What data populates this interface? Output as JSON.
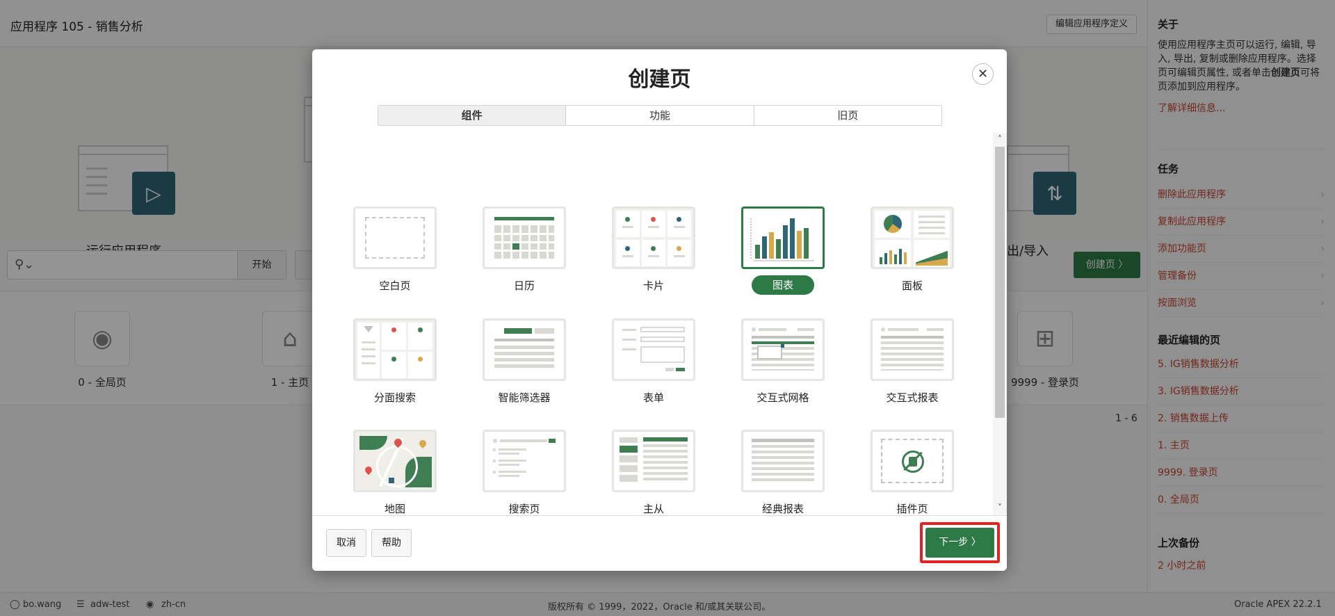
{
  "app": {
    "title": "应用程序 105 - 销售分析",
    "edit_definition_label": "编辑应用程序定义",
    "hero": {
      "run_label": "运行应用程序",
      "export_label": "出/导入"
    },
    "search": {
      "go_label": "开始",
      "value": "",
      "placeholder": ""
    },
    "create_page_label": "创建页 〉",
    "pages": [
      {
        "label": "0 - 全局页",
        "icon": "globe-icon"
      },
      {
        "label": "1 - 主页",
        "icon": "home-icon"
      },
      {
        "label": "9999 - 登录页",
        "icon": "lock-icon"
      }
    ],
    "pager_text": "1 - 6"
  },
  "sidebar": {
    "about_heading": "关于",
    "about_text_before": "使用应用程序主页可以运行, 编辑, 导入, 导出, 复制或删除应用程序。选择页可编辑页属性, 或者单击",
    "about_text_bold": "创建页",
    "about_text_after": "可将页添加到应用程序。",
    "learn_more": "了解详细信息...",
    "tasks_heading": "任务",
    "tasks": [
      "删除此应用程序",
      "复制此应用程序",
      "添加功能页",
      "管理备份",
      "按面浏览"
    ],
    "recent_heading": "最近编辑的页",
    "recent": [
      "5. IG销售数据分析",
      "3. IG销售数据分析",
      "2. 销售数据上传",
      "1. 主页",
      "9999. 登录页",
      "0. 全局页"
    ],
    "backup_heading": "上次备份",
    "backup_value": "2 小时之前"
  },
  "footer": {
    "user": "bo.wang",
    "workspace": "adw-test",
    "language": "zh-cn",
    "copyright": "版权所有 © 1999，2022，Oracle 和/或其关联公司。",
    "version": "Oracle APEX 22.2.1"
  },
  "modal": {
    "title": "创建页",
    "close_icon": "close-icon",
    "tabs": [
      {
        "label": "组件",
        "active": true
      },
      {
        "label": "功能",
        "active": false
      },
      {
        "label": "旧页",
        "active": false
      }
    ],
    "items": [
      {
        "label": "空白页",
        "type": "blank"
      },
      {
        "label": "日历",
        "type": "calendar"
      },
      {
        "label": "卡片",
        "type": "cards"
      },
      {
        "label": "图表",
        "type": "chart",
        "selected": true
      },
      {
        "label": "面板",
        "type": "dashboard"
      },
      {
        "label": "分面搜索",
        "type": "faceted"
      },
      {
        "label": "智能筛选器",
        "type": "smartfilter"
      },
      {
        "label": "表单",
        "type": "form"
      },
      {
        "label": "交互式网格",
        "type": "ig"
      },
      {
        "label": "交互式报表",
        "type": "ir"
      },
      {
        "label": "地图",
        "type": "map"
      },
      {
        "label": "搜索页",
        "type": "search"
      },
      {
        "label": "主从",
        "type": "masterdetail"
      },
      {
        "label": "经典报表",
        "type": "classic"
      },
      {
        "label": "插件页",
        "type": "plugin"
      }
    ],
    "cancel_label": "取消",
    "help_label": "帮助",
    "next_label": "下一步 〉"
  },
  "colors": {
    "accent_green": "#2d7a46",
    "highlight_red": "#e32222",
    "link": "#c74634",
    "badge_teal": "#2e6675"
  }
}
